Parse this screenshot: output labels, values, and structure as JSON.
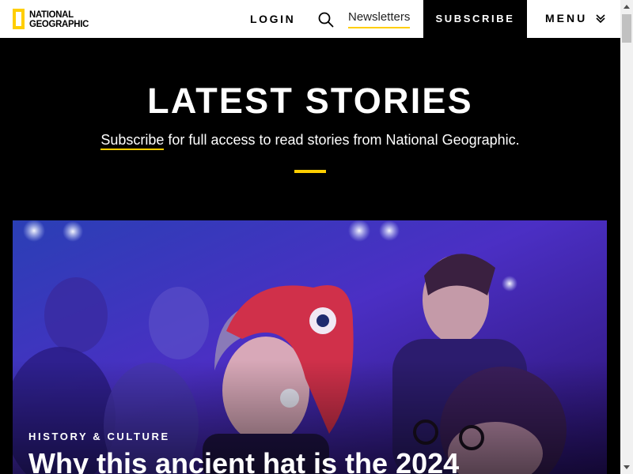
{
  "header": {
    "logo_line1": "NATIONAL",
    "logo_line2": "GEOGRAPHIC",
    "login_label": "LOGIN",
    "search_icon": "search-icon",
    "newsletters_label": "Newsletters",
    "subscribe_label": "SUBSCRIBE",
    "menu_label": "MENU",
    "menu_icon": "chevron-down-icon"
  },
  "hero": {
    "title": "LATEST STORIES",
    "subtitle_link": "Subscribe",
    "subtitle_rest": " for full access to read stories from National Geographic."
  },
  "story": {
    "kicker": "HISTORY & CULTURE",
    "headline": "Why this ancient hat is the 2024"
  },
  "colors": {
    "brand_yellow": "#ffce00",
    "header_bg": "#ffffff",
    "page_bg": "#000000",
    "photo_tint": "#3a1a9a"
  }
}
